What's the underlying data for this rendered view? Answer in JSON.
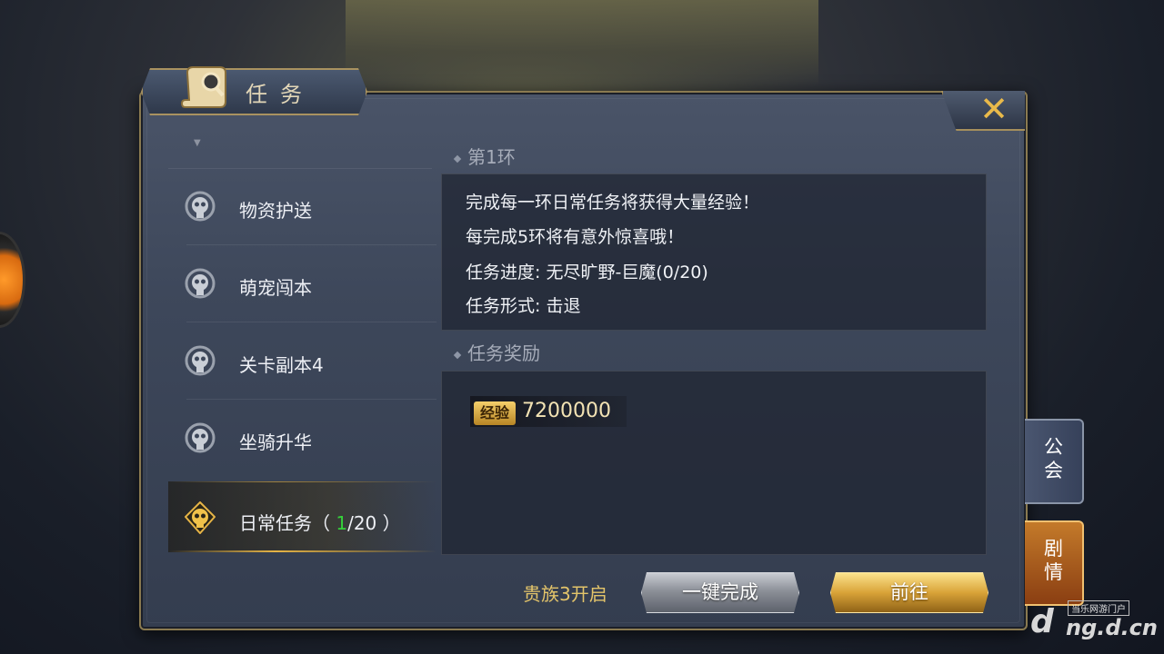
{
  "window": {
    "title": "任务",
    "close_symbol": "✕"
  },
  "task_list": {
    "items": [
      {
        "label": "物资护送",
        "icon": "skull-emblem-icon",
        "active": false
      },
      {
        "label": "萌宠闯本",
        "icon": "skull-emblem-icon",
        "active": false
      },
      {
        "label": "关卡副本4",
        "icon": "skull-emblem-icon",
        "active": false
      },
      {
        "label": "坐骑升华",
        "icon": "skull-emblem-icon",
        "active": false
      }
    ],
    "active_item": {
      "label_prefix": "日常任务（ ",
      "progress_current": "1",
      "progress_rest": "/20 ）",
      "icon": "skull-emblem-icon"
    }
  },
  "detail": {
    "round_title": "第1环",
    "description": [
      "完成每一环日常任务将获得大量经验！",
      "每完成5环将有意外惊喜哦！",
      "任务进度: 无尽旷野-巨魔(0/20)",
      "任务形式: 击退"
    ],
    "reward_title": "任务奖励",
    "reward": {
      "badge": "经验",
      "value": "7200000"
    }
  },
  "footer": {
    "noble_hint": "贵族3开启",
    "complete_all_button": "一键完成",
    "go_button": "前往"
  },
  "side_tabs": {
    "guild": "公\n会",
    "story": "剧\n情"
  },
  "watermark": {
    "small": "当乐网游门户",
    "big": "ng.d.cn",
    "logo": "d"
  },
  "colors": {
    "accent_gold": "#e6b446",
    "progress_green": "#35d13a",
    "panel_bg": "#3d475a"
  }
}
